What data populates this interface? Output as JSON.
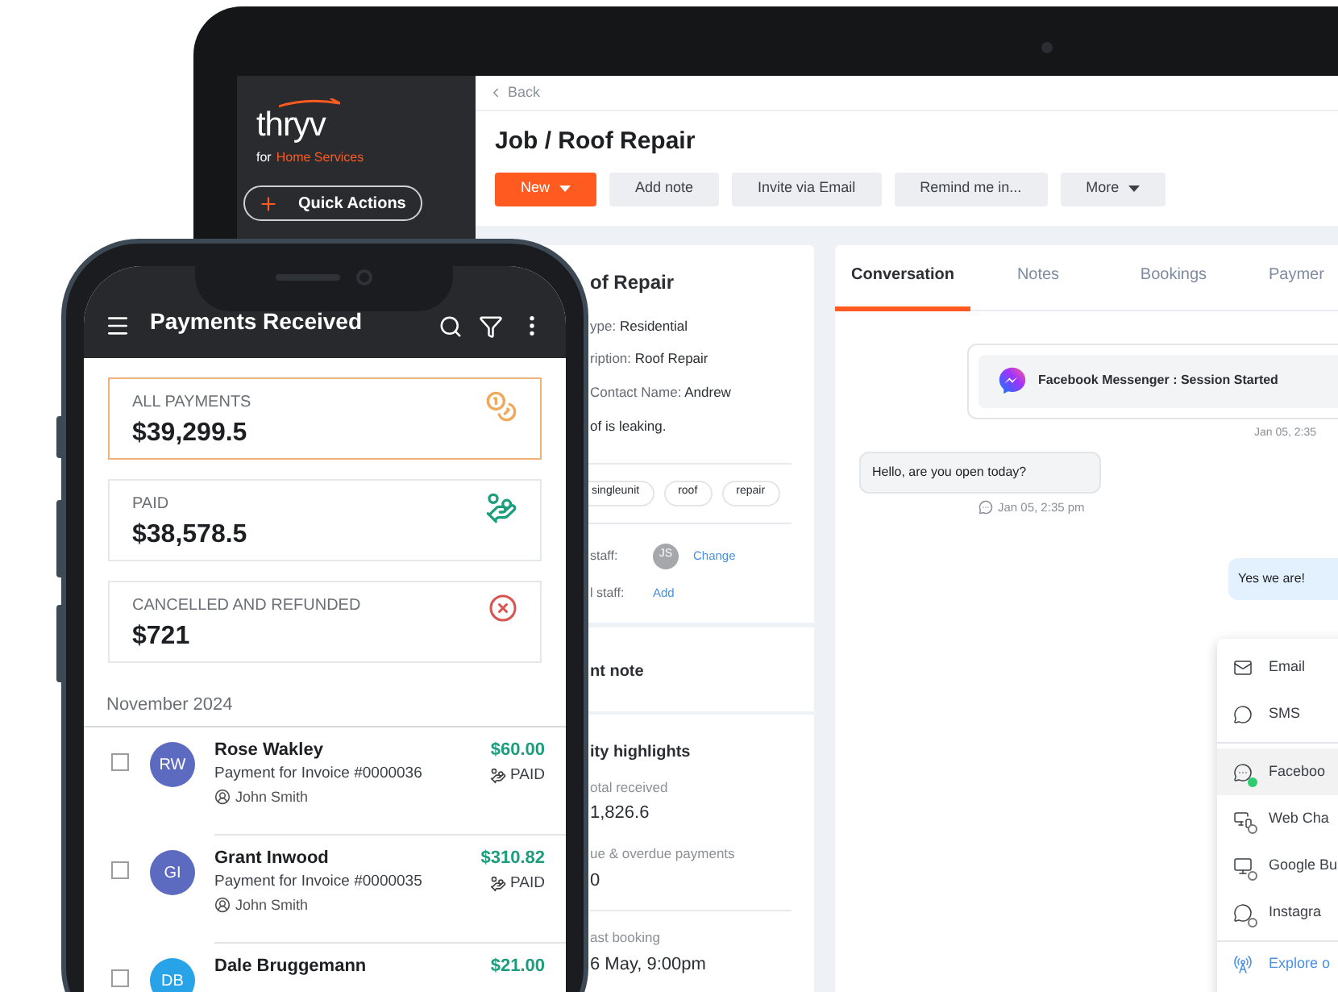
{
  "laptop": {
    "sidebar": {
      "logo": "thryv",
      "tagline_prefix": "for",
      "tagline": "Home Services",
      "quick_action": "Quick Actions"
    },
    "header": {
      "back": "Back",
      "title": "Job / Roof Repair",
      "actions": [
        {
          "label": "New",
          "kind": "primary",
          "menu": true
        },
        {
          "label": "Add note",
          "kind": "secondary",
          "menu": false
        },
        {
          "label": "Invite via Email",
          "kind": "secondary",
          "menu": false
        },
        {
          "label": "Remind me in...",
          "kind": "secondary",
          "menu": false
        },
        {
          "label": "More",
          "kind": "secondary",
          "menu": true
        }
      ]
    },
    "details_card": {
      "title": "of Repair",
      "fields": [
        {
          "label": "ype:",
          "value": "Residential"
        },
        {
          "label": "ription:",
          "value": "Roof Repair"
        },
        {
          "label": "Contact Name:",
          "value": "Andrew"
        },
        {
          "value": "of is leaking."
        }
      ],
      "tags": [
        "singleunit",
        "roof",
        "repair"
      ],
      "staff": [
        {
          "label": "staff:",
          "avatar": "JS",
          "action": "Change"
        },
        {
          "label": "l staff:",
          "action": "Add"
        }
      ],
      "note_title": "nt note",
      "highlights_title": "ity highlights",
      "highlights": [
        {
          "label": "otal received",
          "value": "1,826.6"
        },
        {
          "label": "ue & overdue payments",
          "value": "0"
        },
        {
          "label": "ast booking",
          "value": "6 May, 9:00pm"
        }
      ]
    },
    "conversation": {
      "tabs": [
        {
          "label": "Conversation",
          "selected": true
        },
        {
          "label": "Notes",
          "selected": false
        },
        {
          "label": "Bookings",
          "selected": false
        },
        {
          "label": "Paymer",
          "selected": false
        }
      ],
      "session": "Facebook Messenger : Session Started",
      "session_time": "Jan 05, 2:35",
      "messages": [
        {
          "text": "Hello, are you open today?",
          "time": "Jan 05, 2:35 pm",
          "kind": "incoming"
        },
        {
          "text": "Yes we are!",
          "kind": "outgoing"
        }
      ],
      "channel_menu": [
        [
          {
            "label": "Email",
            "kind": "email",
            "selected": false
          },
          {
            "label": "SMS",
            "kind": "sms",
            "selected": false
          }
        ],
        [
          {
            "label": "Faceboo",
            "kind": "messenger",
            "selected": true,
            "connected": true
          },
          {
            "label": "Web Cha",
            "kind": "webchat",
            "selected": false,
            "connected": false
          },
          {
            "label": "Google Bu",
            "kind": "google",
            "selected": false,
            "connected": false
          },
          {
            "label": "Instagra",
            "kind": "instagram",
            "selected": false,
            "connected": false
          }
        ],
        [
          {
            "label": "Explore o",
            "kind": "link",
            "selected": false
          }
        ]
      ]
    }
  },
  "phone": {
    "title": "Payments Received",
    "summary": [
      {
        "label": "ALL PAYMENTS",
        "value": "$39,299.5",
        "kind": "all",
        "selected": true
      },
      {
        "label": "PAID",
        "value": "$38,578.5",
        "kind": "paid",
        "selected": false
      },
      {
        "label": "CANCELLED AND REFUNDED",
        "value": "$721",
        "kind": "cancelled",
        "selected": false
      }
    ],
    "month": "November 2024",
    "payments": [
      {
        "initials": "RW",
        "color": "#5c6bc0",
        "name": "Rose Wakley",
        "description": "Payment for Invoice #0000036",
        "staff": "John Smith",
        "amount": "$60.00",
        "status": "PAID",
        "checked": false
      },
      {
        "initials": "GI",
        "color": "#5c6bc0",
        "name": "Grant Inwood",
        "description": "Payment for Invoice #0000035",
        "staff": "John Smith",
        "amount": "$310.82",
        "status": "PAID",
        "checked": false
      },
      {
        "initials": "DB",
        "color": "#29a3e8",
        "name": "Dale Bruggemann",
        "amount": "$21.00",
        "checked": false
      }
    ]
  }
}
